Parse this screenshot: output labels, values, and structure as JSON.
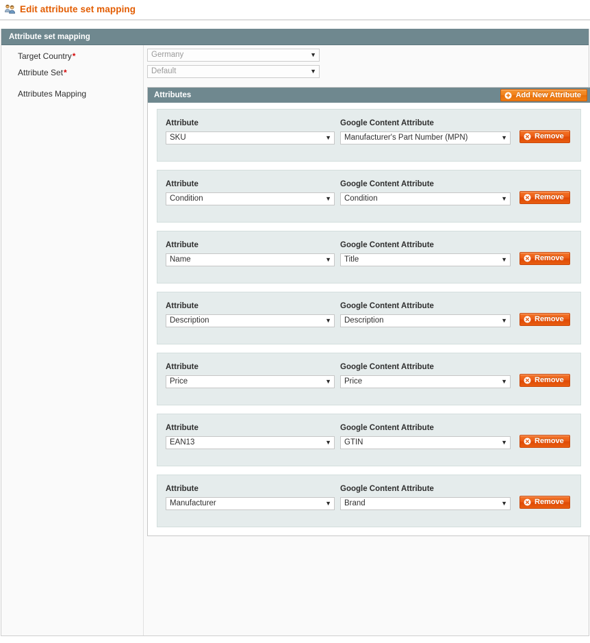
{
  "header": {
    "icon": "users-group-icon",
    "title": "Edit attribute set mapping"
  },
  "fieldset": {
    "legend": "Attribute set mapping"
  },
  "form": {
    "target_country": {
      "label": "Target Country",
      "required_marker": "*",
      "value": "Germany",
      "disabled": true
    },
    "attribute_set": {
      "label": "Attribute Set",
      "required_marker": "*",
      "value": "Default",
      "disabled": true
    },
    "attributes_mapping": {
      "label": "Attributes Mapping"
    }
  },
  "attributes_panel": {
    "title": "Attributes",
    "add_button": {
      "label": "Add New Attribute",
      "icon": "circle-plus-icon"
    },
    "column_labels": {
      "attribute": "Attribute",
      "google_content_attribute": "Google Content Attribute"
    },
    "remove_button": {
      "label": "Remove",
      "icon": "circle-x-icon"
    },
    "rows": [
      {
        "attribute": "SKU",
        "google_content_attribute": "Manufacturer's Part Number (MPN)"
      },
      {
        "attribute": "Condition",
        "google_content_attribute": "Condition"
      },
      {
        "attribute": "Name",
        "google_content_attribute": "Title"
      },
      {
        "attribute": "Description",
        "google_content_attribute": "Description"
      },
      {
        "attribute": "Price",
        "google_content_attribute": "Price"
      },
      {
        "attribute": "EAN13",
        "google_content_attribute": "GTIN"
      },
      {
        "attribute": "Manufacturer",
        "google_content_attribute": "Brand"
      }
    ]
  },
  "colors": {
    "title_orange": "#e25c00",
    "panel_header_slate": "#6f888f",
    "row_background": "#e5ecec",
    "button_orange": "#ef7f16",
    "remove_orange": "#e25110",
    "required_red": "#d40707"
  },
  "icons": {
    "caret_down": "▼"
  }
}
